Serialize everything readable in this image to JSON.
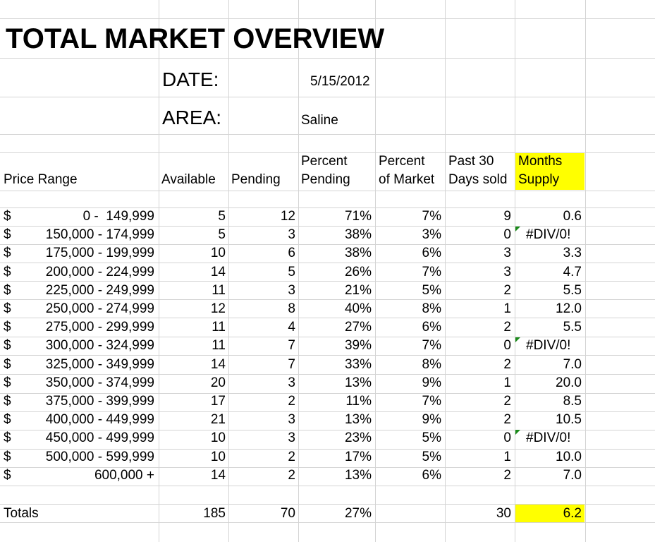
{
  "title": "TOTAL MARKET OVERVIEW",
  "date_label": "DATE:",
  "date_value": "5/15/2012",
  "area_label": "AREA:",
  "area_value": "Saline",
  "headers": {
    "price_range": "Price Range",
    "available": "Available",
    "pending": "Pending",
    "percent_pending_1": "Percent",
    "percent_pending_2": "Pending",
    "percent_market_1": "Percent",
    "percent_market_2": "of Market",
    "past30_1": "Past 30",
    "past30_2": "Days sold",
    "months_1": "Months",
    "months_2": "Supply"
  },
  "highlight_color": "#ffff00",
  "comment_marker_color": "#1a8a1a",
  "rows": [
    {
      "currency": "$",
      "range": "0 -  149,999",
      "available": "5",
      "pending": "12",
      "pct_pending": "71%",
      "pct_market": "7%",
      "sold": "9",
      "supply": "0.6",
      "comment": false
    },
    {
      "currency": "$",
      "range": "150,000 - 174,999",
      "available": "5",
      "pending": "3",
      "pct_pending": "38%",
      "pct_market": "3%",
      "sold": "0",
      "supply": "#DIV/0!",
      "comment": true
    },
    {
      "currency": "$",
      "range": "175,000 - 199,999",
      "available": "10",
      "pending": "6",
      "pct_pending": "38%",
      "pct_market": "6%",
      "sold": "3",
      "supply": "3.3",
      "comment": false
    },
    {
      "currency": "$",
      "range": "200,000 - 224,999",
      "available": "14",
      "pending": "5",
      "pct_pending": "26%",
      "pct_market": "7%",
      "sold": "3",
      "supply": "4.7",
      "comment": false
    },
    {
      "currency": "$",
      "range": "225,000 - 249,999",
      "available": "11",
      "pending": "3",
      "pct_pending": "21%",
      "pct_market": "5%",
      "sold": "2",
      "supply": "5.5",
      "comment": false
    },
    {
      "currency": "$",
      "range": "250,000 - 274,999",
      "available": "12",
      "pending": "8",
      "pct_pending": "40%",
      "pct_market": "8%",
      "sold": "1",
      "supply": "12.0",
      "comment": false
    },
    {
      "currency": "$",
      "range": "275,000 - 299,999",
      "available": "11",
      "pending": "4",
      "pct_pending": "27%",
      "pct_market": "6%",
      "sold": "2",
      "supply": "5.5",
      "comment": false
    },
    {
      "currency": "$",
      "range": "300,000 - 324,999",
      "available": "11",
      "pending": "7",
      "pct_pending": "39%",
      "pct_market": "7%",
      "sold": "0",
      "supply": "#DIV/0!",
      "comment": true
    },
    {
      "currency": "$",
      "range": "325,000 - 349,999",
      "available": "14",
      "pending": "7",
      "pct_pending": "33%",
      "pct_market": "8%",
      "sold": "2",
      "supply": "7.0",
      "comment": false
    },
    {
      "currency": "$",
      "range": "350,000 - 374,999",
      "available": "20",
      "pending": "3",
      "pct_pending": "13%",
      "pct_market": "9%",
      "sold": "1",
      "supply": "20.0",
      "comment": false
    },
    {
      "currency": "$",
      "range": "375,000 - 399,999",
      "available": "17",
      "pending": "2",
      "pct_pending": "11%",
      "pct_market": "7%",
      "sold": "2",
      "supply": "8.5",
      "comment": false
    },
    {
      "currency": "$",
      "range": "400,000 - 449,999",
      "available": "21",
      "pending": "3",
      "pct_pending": "13%",
      "pct_market": "9%",
      "sold": "2",
      "supply": "10.5",
      "comment": false
    },
    {
      "currency": "$",
      "range": "450,000 - 499,999",
      "available": "10",
      "pending": "3",
      "pct_pending": "23%",
      "pct_market": "5%",
      "sold": "0",
      "supply": "#DIV/0!",
      "comment": true
    },
    {
      "currency": "$",
      "range": "500,000 - 599,999",
      "available": "10",
      "pending": "2",
      "pct_pending": "17%",
      "pct_market": "5%",
      "sold": "1",
      "supply": "10.0",
      "comment": false
    },
    {
      "currency": "$",
      "range": "600,000 +",
      "available": "14",
      "pending": "2",
      "pct_pending": "13%",
      "pct_market": "6%",
      "sold": "2",
      "supply": "7.0",
      "comment": false
    }
  ],
  "totals": {
    "label": "Totals",
    "available": "185",
    "pending": "70",
    "pct_pending": "27%",
    "sold": "30",
    "supply": "6.2"
  }
}
